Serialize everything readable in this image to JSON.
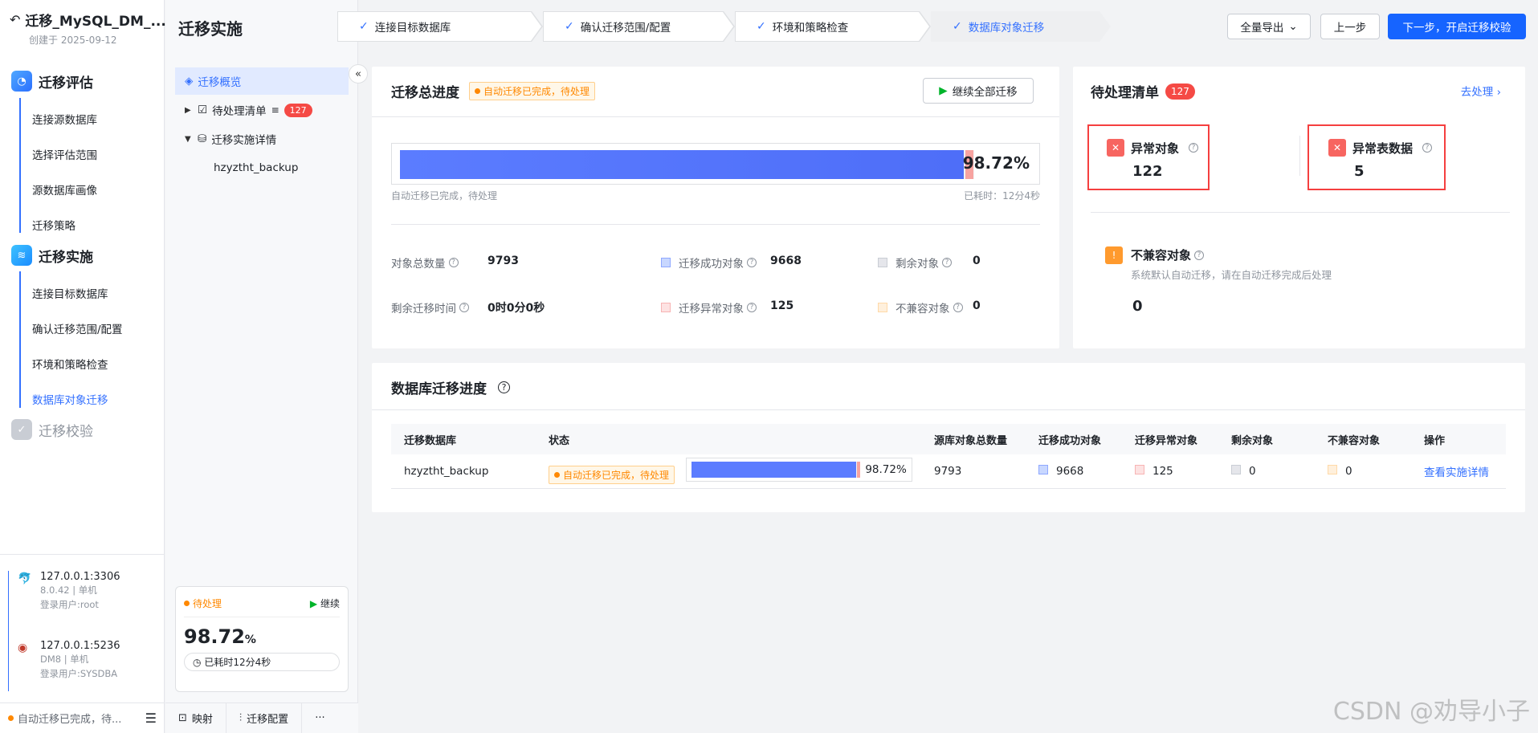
{
  "project": {
    "name": "迁移_MySQL_DM_...",
    "created": "创建于 2025-09-12"
  },
  "phases": [
    {
      "title": "迁移评估",
      "items": [
        "连接源数据库",
        "选择评估范围",
        "源数据库画像",
        "迁移策略"
      ]
    },
    {
      "title": "迁移实施",
      "items": [
        "连接目标数据库",
        "确认迁移范围/配置",
        "环境和策略检查",
        "数据库对象迁移"
      ]
    },
    {
      "title": "迁移校验",
      "items": []
    }
  ],
  "connections": [
    {
      "host": "127.0.0.1:3306",
      "meta": "8.0.42 | 单机",
      "user": "登录用户:root"
    },
    {
      "host": "127.0.0.1:5236",
      "meta": "DM8 | 单机",
      "user": "登录用户:SYSDBA"
    }
  ],
  "sidebar_footer": {
    "status": "自动迁移已完成，待..."
  },
  "page_title": "迁移实施",
  "tree": {
    "overview": "迁移概览",
    "pending": "待处理清单",
    "pending_count": "127",
    "details": "迁移实施详情",
    "db": "hzyztht_backup"
  },
  "mini_card": {
    "status": "待处理",
    "continue": "继续",
    "percent": "98.72",
    "percent_unit": "%",
    "elapsed": "已耗时12分4秒"
  },
  "nav2_footer": {
    "map": "映射",
    "config": "迁移配置",
    "more": "···"
  },
  "steps": [
    {
      "label": "连接目标数据库"
    },
    {
      "label": "确认迁移范围/配置"
    },
    {
      "label": "环境和策略检查"
    },
    {
      "label": "数据库对象迁移"
    }
  ],
  "toolbar": {
    "export": "全量导出",
    "prev": "上一步",
    "next": "下一步，开启迁移校验"
  },
  "overall": {
    "title": "迁移总进度",
    "tag": "自动迁移已完成，待处理",
    "continue_all": "继续全部迁移",
    "percent": "98.72%",
    "success_fraction": 0.9872,
    "error_fraction": 0.0128,
    "caption": "自动迁移已完成，待处理",
    "elapsed": "已耗时：12分4秒",
    "stats": {
      "total_label": "对象总数量",
      "total": "9793",
      "success_label": "迁移成功对象",
      "success": "9668",
      "remain_label": "剩余对象",
      "remain": "0",
      "remain_time_label": "剩余迁移时间",
      "remain_time": "0时0分0秒",
      "error_label": "迁移异常对象",
      "error": "125",
      "incompat_label": "不兼容对象",
      "incompat": "0"
    }
  },
  "pending": {
    "title": "待处理清单",
    "count": "127",
    "go": "去处理",
    "abnormal_obj_label": "异常对象",
    "abnormal_obj": "122",
    "abnormal_data_label": "异常表数据",
    "abnormal_data": "5",
    "incompat_label": "不兼容对象",
    "incompat_desc": "系统默认自动迁移，请在自动迁移完成后处理",
    "incompat": "0"
  },
  "db_progress": {
    "title": "数据库迁移进度",
    "columns": [
      "迁移数据库",
      "状态",
      "源库对象总数量",
      "迁移成功对象",
      "迁移异常对象",
      "剩余对象",
      "不兼容对象",
      "操作"
    ],
    "rows": [
      {
        "db": "hzyztht_backup",
        "status": "自动迁移已完成，待处理",
        "percent": "98.72%",
        "success_fraction": 0.9872,
        "total": "9793",
        "success": "9668",
        "error": "125",
        "remain": "0",
        "incompat": "0",
        "action": "查看实施详情"
      }
    ]
  },
  "watermark": "CSDN @劝导小子",
  "colors": {
    "accent": "#3370ff",
    "warn": "#ff8800",
    "danger": "#f53f3f",
    "bar": "#5b7cff",
    "bar_err": "#f7a3a0"
  }
}
